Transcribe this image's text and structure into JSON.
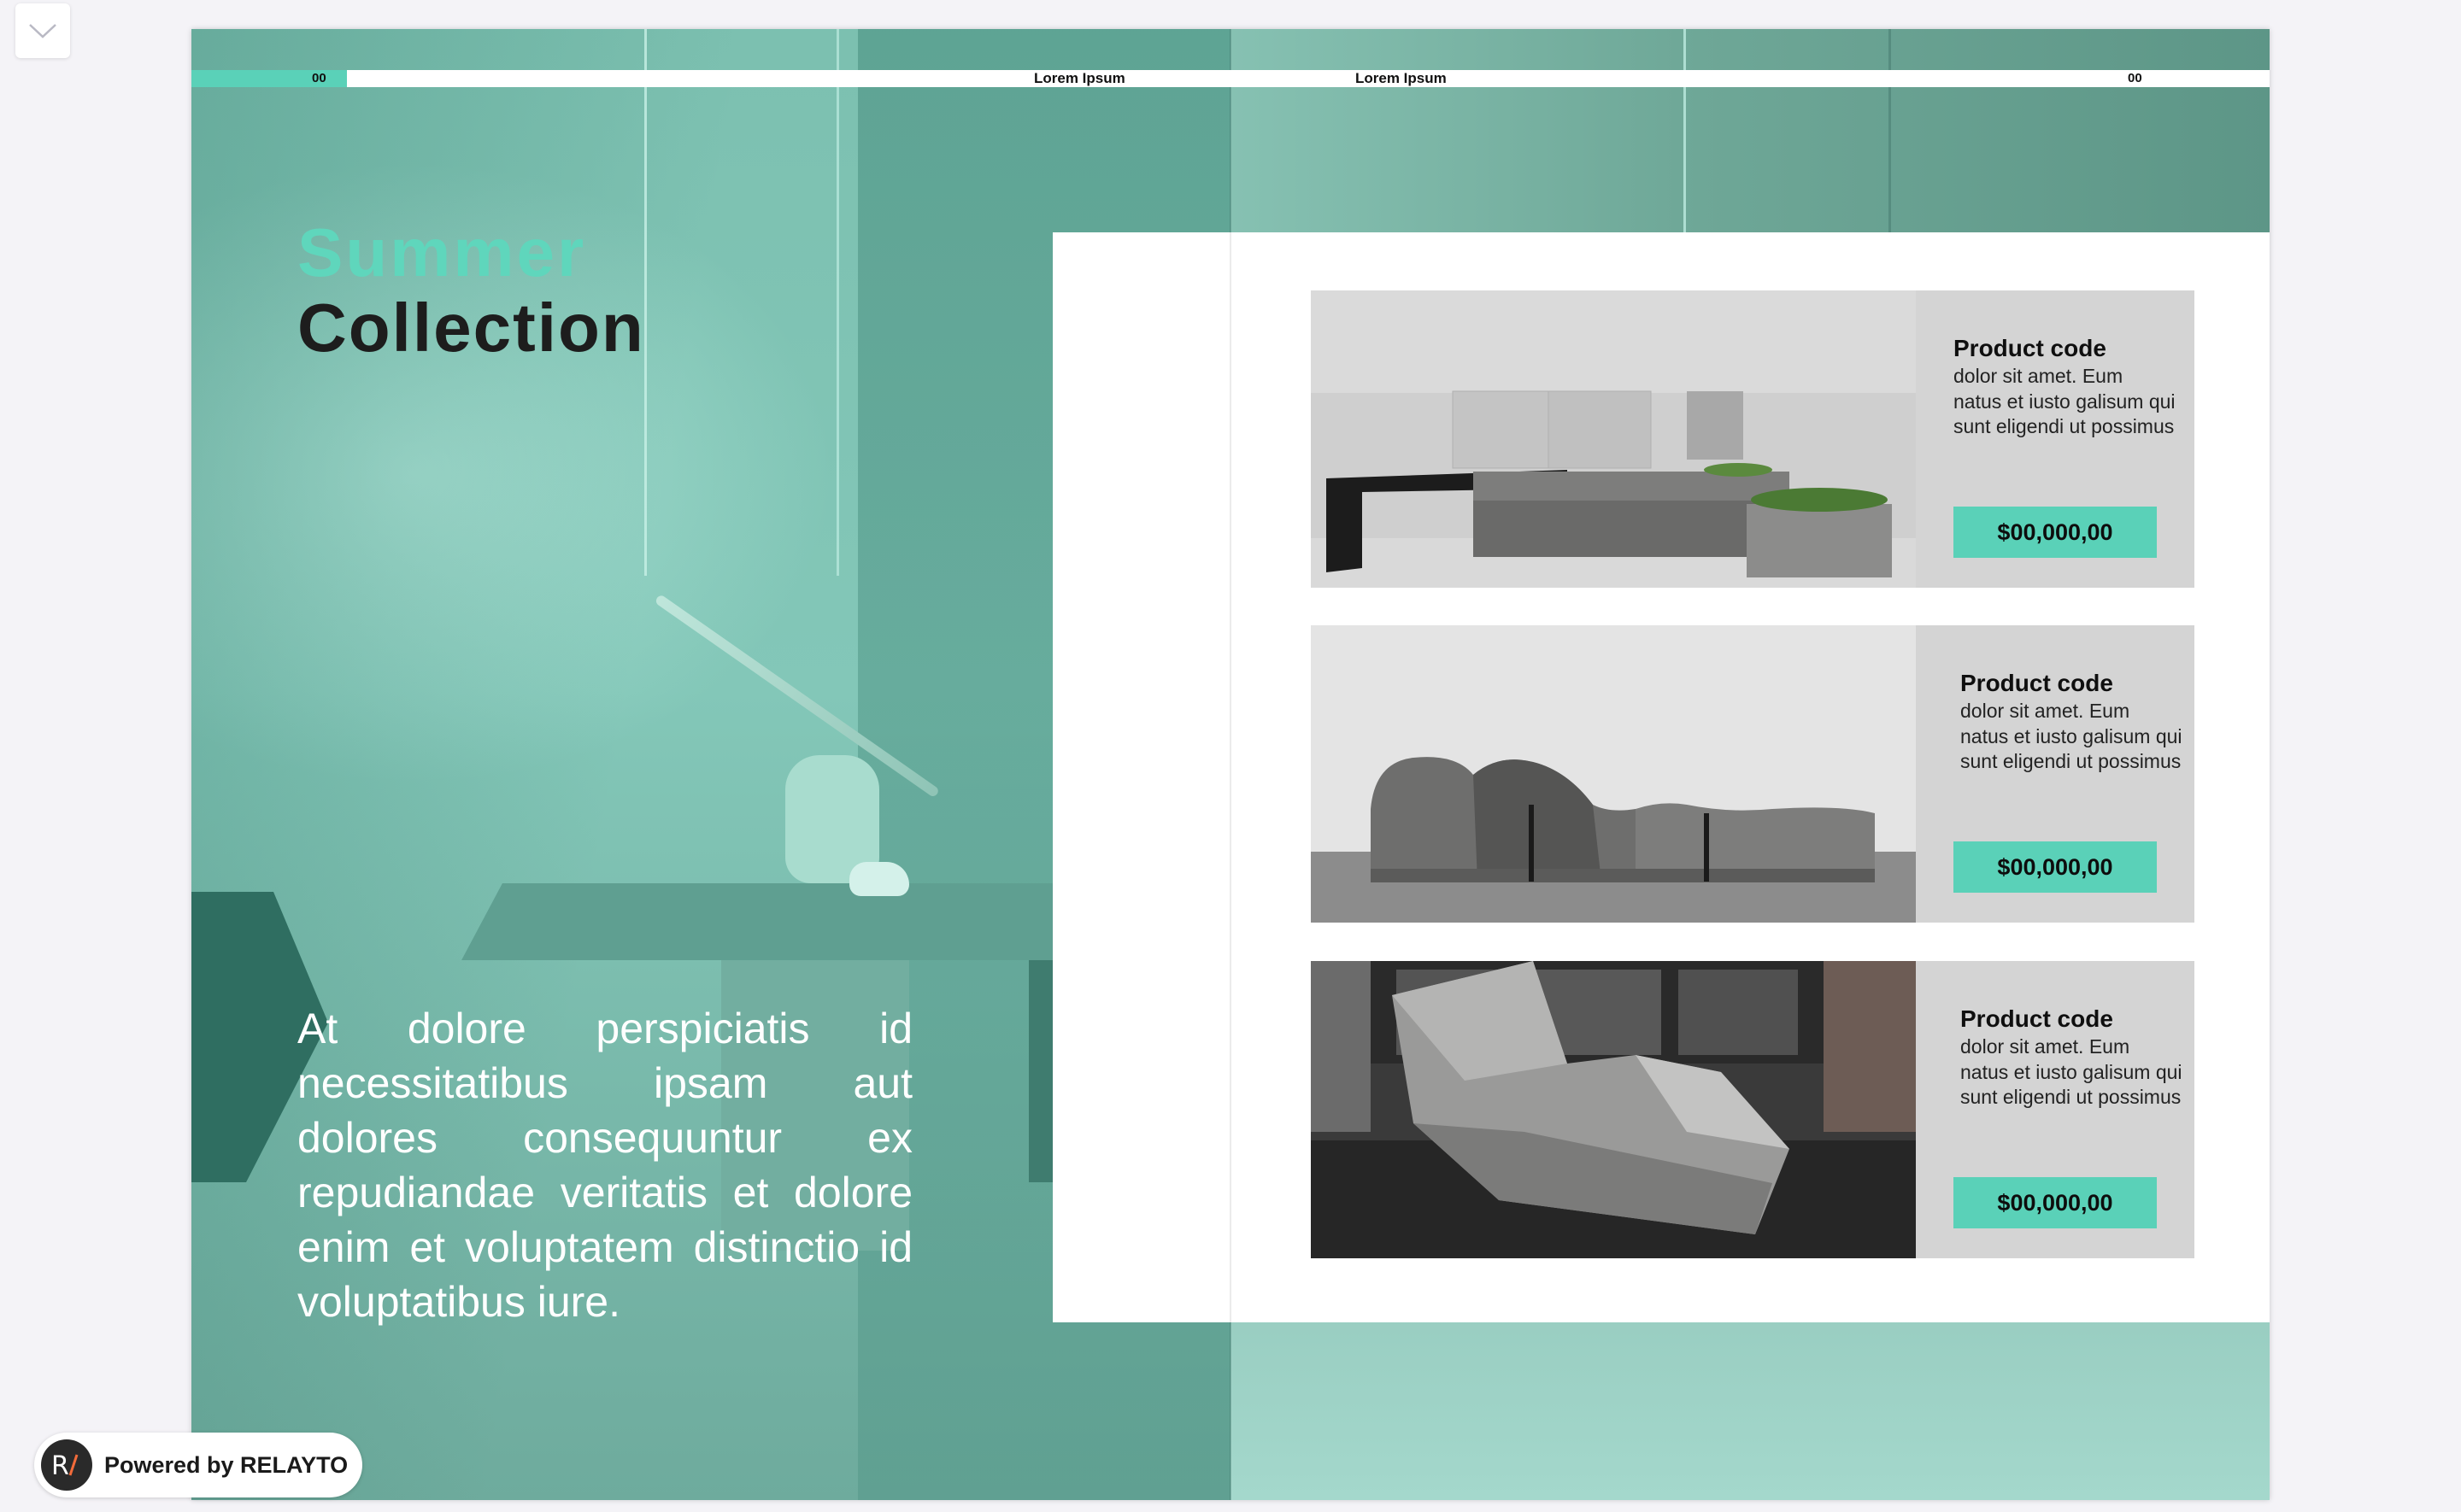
{
  "toolbar": {
    "collapse_icon": "chevron-down-icon"
  },
  "header": {
    "left_page_number": "00",
    "right_page_number": "00",
    "left_running_title": "Lorem Ipsum",
    "right_running_title": "Lorem Ipsum"
  },
  "headline": {
    "accent": "Summer",
    "main": "Collection"
  },
  "body_copy": "At dolore perspiciatis id necessitatibus ipsam aut dolores consequuntur ex repudiandae veritatis et dolore enim et voluptatem distinctio id voluptatibus iure.",
  "products": [
    {
      "code": "Product code",
      "description": "dolor sit amet. Eum natus et iusto galisum qui sunt eligendi ut possimus",
      "price": "$00,000,00",
      "image": "concrete-kitchen-island"
    },
    {
      "code": "Product code",
      "description": "dolor sit amet. Eum natus et iusto galisum qui sunt eligendi ut possimus",
      "price": "$00,000,00",
      "image": "concrete-lounge-bench"
    },
    {
      "code": "Product code",
      "description": "dolor sit amet. Eum natus et iusto galisum qui sunt eligendi ut possimus",
      "price": "$00,000,00",
      "image": "concrete-chaise"
    }
  ],
  "badge": {
    "label": "Powered by RELAYTO",
    "logo_text": "R/"
  },
  "colors": {
    "accent": "#5ad1b8",
    "headline_accent": "#5fd6bc",
    "card_panel": "#d4d4d4"
  }
}
